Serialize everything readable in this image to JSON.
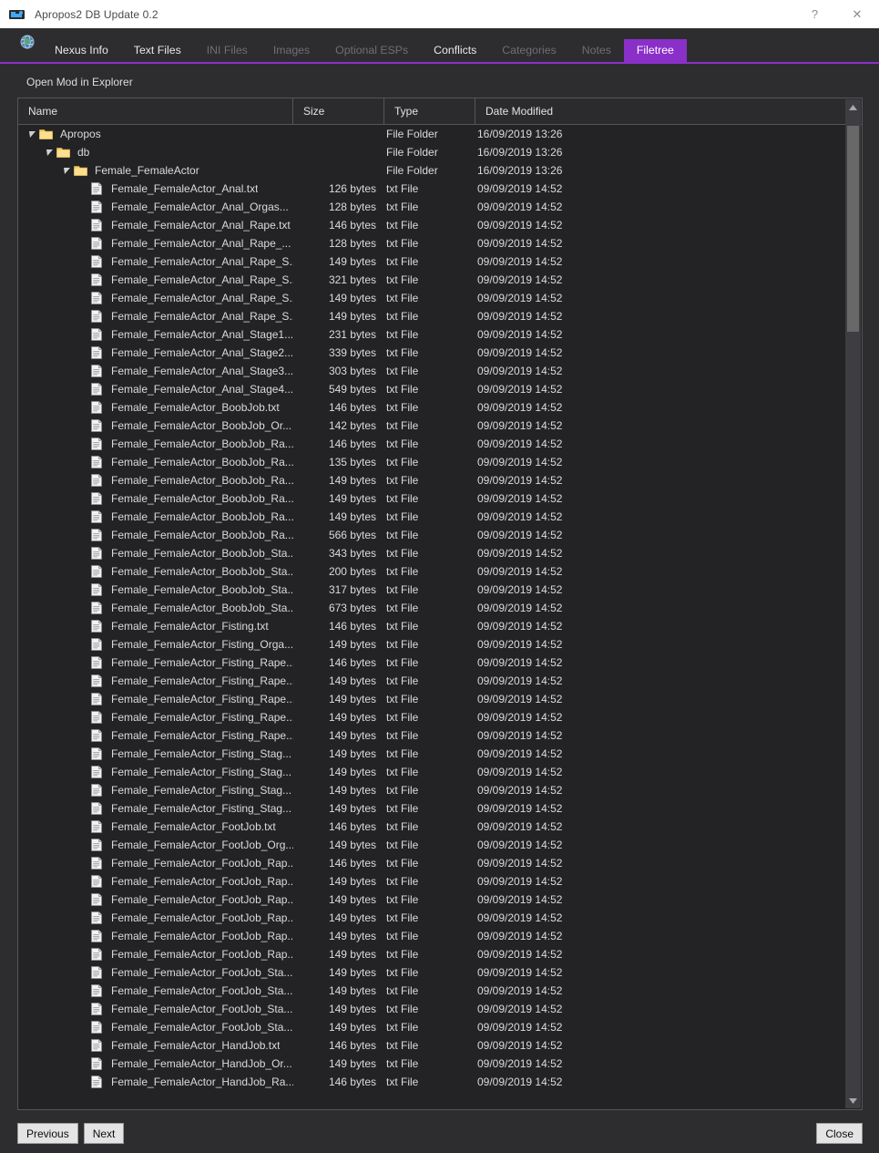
{
  "window": {
    "title": "Apropos2 DB Update 0.2",
    "icon": "window-icon",
    "help_label": "?",
    "close_label": "✕"
  },
  "tabs": [
    {
      "label": "Nexus Info",
      "state": "normal",
      "icon": "globe-icon"
    },
    {
      "label": "Text Files",
      "state": "normal"
    },
    {
      "label": "INI Files",
      "state": "disabled"
    },
    {
      "label": "Images",
      "state": "disabled"
    },
    {
      "label": "Optional ESPs",
      "state": "disabled"
    },
    {
      "label": "Conflicts",
      "state": "normal"
    },
    {
      "label": "Categories",
      "state": "disabled"
    },
    {
      "label": "Notes",
      "state": "disabled"
    },
    {
      "label": "Filetree",
      "state": "active"
    }
  ],
  "accent_color": "#8b2fc9",
  "toolbar": {
    "open_mod_label": "Open Mod in Explorer"
  },
  "tree": {
    "columns": [
      "Name",
      "Size",
      "Type",
      "Date Modified"
    ],
    "rows": [
      {
        "depth": 0,
        "kind": "folder",
        "expanded": true,
        "name": "Apropos",
        "size": "",
        "type": "File Folder",
        "date": "16/09/2019 13:26"
      },
      {
        "depth": 1,
        "kind": "folder",
        "expanded": true,
        "name": "db",
        "size": "",
        "type": "File Folder",
        "date": "16/09/2019 13:26"
      },
      {
        "depth": 2,
        "kind": "folder",
        "expanded": true,
        "name": "Female_FemaleActor",
        "size": "",
        "type": "File Folder",
        "date": "16/09/2019 13:26"
      },
      {
        "depth": 3,
        "kind": "file",
        "name": "Female_FemaleActor_Anal.txt",
        "size": "126 bytes",
        "type": "txt File",
        "date": "09/09/2019 14:52"
      },
      {
        "depth": 3,
        "kind": "file",
        "name": "Female_FemaleActor_Anal_Orgas...",
        "size": "128 bytes",
        "type": "txt File",
        "date": "09/09/2019 14:52"
      },
      {
        "depth": 3,
        "kind": "file",
        "name": "Female_FemaleActor_Anal_Rape.txt",
        "size": "146 bytes",
        "type": "txt File",
        "date": "09/09/2019 14:52"
      },
      {
        "depth": 3,
        "kind": "file",
        "name": "Female_FemaleActor_Anal_Rape_...",
        "size": "128 bytes",
        "type": "txt File",
        "date": "09/09/2019 14:52"
      },
      {
        "depth": 3,
        "kind": "file",
        "name": "Female_FemaleActor_Anal_Rape_S...",
        "size": "149 bytes",
        "type": "txt File",
        "date": "09/09/2019 14:52"
      },
      {
        "depth": 3,
        "kind": "file",
        "name": "Female_FemaleActor_Anal_Rape_S...",
        "size": "321 bytes",
        "type": "txt File",
        "date": "09/09/2019 14:52"
      },
      {
        "depth": 3,
        "kind": "file",
        "name": "Female_FemaleActor_Anal_Rape_S...",
        "size": "149 bytes",
        "type": "txt File",
        "date": "09/09/2019 14:52"
      },
      {
        "depth": 3,
        "kind": "file",
        "name": "Female_FemaleActor_Anal_Rape_S...",
        "size": "149 bytes",
        "type": "txt File",
        "date": "09/09/2019 14:52"
      },
      {
        "depth": 3,
        "kind": "file",
        "name": "Female_FemaleActor_Anal_Stage1....",
        "size": "231 bytes",
        "type": "txt File",
        "date": "09/09/2019 14:52"
      },
      {
        "depth": 3,
        "kind": "file",
        "name": "Female_FemaleActor_Anal_Stage2....",
        "size": "339 bytes",
        "type": "txt File",
        "date": "09/09/2019 14:52"
      },
      {
        "depth": 3,
        "kind": "file",
        "name": "Female_FemaleActor_Anal_Stage3....",
        "size": "303 bytes",
        "type": "txt File",
        "date": "09/09/2019 14:52"
      },
      {
        "depth": 3,
        "kind": "file",
        "name": "Female_FemaleActor_Anal_Stage4....",
        "size": "549 bytes",
        "type": "txt File",
        "date": "09/09/2019 14:52"
      },
      {
        "depth": 3,
        "kind": "file",
        "name": "Female_FemaleActor_BoobJob.txt",
        "size": "146 bytes",
        "type": "txt File",
        "date": "09/09/2019 14:52"
      },
      {
        "depth": 3,
        "kind": "file",
        "name": "Female_FemaleActor_BoobJob_Or...",
        "size": "142 bytes",
        "type": "txt File",
        "date": "09/09/2019 14:52"
      },
      {
        "depth": 3,
        "kind": "file",
        "name": "Female_FemaleActor_BoobJob_Ra...",
        "size": "146 bytes",
        "type": "txt File",
        "date": "09/09/2019 14:52"
      },
      {
        "depth": 3,
        "kind": "file",
        "name": "Female_FemaleActor_BoobJob_Ra...",
        "size": "135 bytes",
        "type": "txt File",
        "date": "09/09/2019 14:52"
      },
      {
        "depth": 3,
        "kind": "file",
        "name": "Female_FemaleActor_BoobJob_Ra...",
        "size": "149 bytes",
        "type": "txt File",
        "date": "09/09/2019 14:52"
      },
      {
        "depth": 3,
        "kind": "file",
        "name": "Female_FemaleActor_BoobJob_Ra...",
        "size": "149 bytes",
        "type": "txt File",
        "date": "09/09/2019 14:52"
      },
      {
        "depth": 3,
        "kind": "file",
        "name": "Female_FemaleActor_BoobJob_Ra...",
        "size": "149 bytes",
        "type": "txt File",
        "date": "09/09/2019 14:52"
      },
      {
        "depth": 3,
        "kind": "file",
        "name": "Female_FemaleActor_BoobJob_Ra...",
        "size": "566 bytes",
        "type": "txt File",
        "date": "09/09/2019 14:52"
      },
      {
        "depth": 3,
        "kind": "file",
        "name": "Female_FemaleActor_BoobJob_Sta...",
        "size": "343 bytes",
        "type": "txt File",
        "date": "09/09/2019 14:52"
      },
      {
        "depth": 3,
        "kind": "file",
        "name": "Female_FemaleActor_BoobJob_Sta...",
        "size": "200 bytes",
        "type": "txt File",
        "date": "09/09/2019 14:52"
      },
      {
        "depth": 3,
        "kind": "file",
        "name": "Female_FemaleActor_BoobJob_Sta...",
        "size": "317 bytes",
        "type": "txt File",
        "date": "09/09/2019 14:52"
      },
      {
        "depth": 3,
        "kind": "file",
        "name": "Female_FemaleActor_BoobJob_Sta...",
        "size": "673 bytes",
        "type": "txt File",
        "date": "09/09/2019 14:52"
      },
      {
        "depth": 3,
        "kind": "file",
        "name": "Female_FemaleActor_Fisting.txt",
        "size": "146 bytes",
        "type": "txt File",
        "date": "09/09/2019 14:52"
      },
      {
        "depth": 3,
        "kind": "file",
        "name": "Female_FemaleActor_Fisting_Orga...",
        "size": "149 bytes",
        "type": "txt File",
        "date": "09/09/2019 14:52"
      },
      {
        "depth": 3,
        "kind": "file",
        "name": "Female_FemaleActor_Fisting_Rape...",
        "size": "146 bytes",
        "type": "txt File",
        "date": "09/09/2019 14:52"
      },
      {
        "depth": 3,
        "kind": "file",
        "name": "Female_FemaleActor_Fisting_Rape...",
        "size": "149 bytes",
        "type": "txt File",
        "date": "09/09/2019 14:52"
      },
      {
        "depth": 3,
        "kind": "file",
        "name": "Female_FemaleActor_Fisting_Rape...",
        "size": "149 bytes",
        "type": "txt File",
        "date": "09/09/2019 14:52"
      },
      {
        "depth": 3,
        "kind": "file",
        "name": "Female_FemaleActor_Fisting_Rape...",
        "size": "149 bytes",
        "type": "txt File",
        "date": "09/09/2019 14:52"
      },
      {
        "depth": 3,
        "kind": "file",
        "name": "Female_FemaleActor_Fisting_Rape...",
        "size": "149 bytes",
        "type": "txt File",
        "date": "09/09/2019 14:52"
      },
      {
        "depth": 3,
        "kind": "file",
        "name": "Female_FemaleActor_Fisting_Stag...",
        "size": "149 bytes",
        "type": "txt File",
        "date": "09/09/2019 14:52"
      },
      {
        "depth": 3,
        "kind": "file",
        "name": "Female_FemaleActor_Fisting_Stag...",
        "size": "149 bytes",
        "type": "txt File",
        "date": "09/09/2019 14:52"
      },
      {
        "depth": 3,
        "kind": "file",
        "name": "Female_FemaleActor_Fisting_Stag...",
        "size": "149 bytes",
        "type": "txt File",
        "date": "09/09/2019 14:52"
      },
      {
        "depth": 3,
        "kind": "file",
        "name": "Female_FemaleActor_Fisting_Stag...",
        "size": "149 bytes",
        "type": "txt File",
        "date": "09/09/2019 14:52"
      },
      {
        "depth": 3,
        "kind": "file",
        "name": "Female_FemaleActor_FootJob.txt",
        "size": "146 bytes",
        "type": "txt File",
        "date": "09/09/2019 14:52"
      },
      {
        "depth": 3,
        "kind": "file",
        "name": "Female_FemaleActor_FootJob_Org...",
        "size": "149 bytes",
        "type": "txt File",
        "date": "09/09/2019 14:52"
      },
      {
        "depth": 3,
        "kind": "file",
        "name": "Female_FemaleActor_FootJob_Rap...",
        "size": "146 bytes",
        "type": "txt File",
        "date": "09/09/2019 14:52"
      },
      {
        "depth": 3,
        "kind": "file",
        "name": "Female_FemaleActor_FootJob_Rap...",
        "size": "149 bytes",
        "type": "txt File",
        "date": "09/09/2019 14:52"
      },
      {
        "depth": 3,
        "kind": "file",
        "name": "Female_FemaleActor_FootJob_Rap...",
        "size": "149 bytes",
        "type": "txt File",
        "date": "09/09/2019 14:52"
      },
      {
        "depth": 3,
        "kind": "file",
        "name": "Female_FemaleActor_FootJob_Rap...",
        "size": "149 bytes",
        "type": "txt File",
        "date": "09/09/2019 14:52"
      },
      {
        "depth": 3,
        "kind": "file",
        "name": "Female_FemaleActor_FootJob_Rap...",
        "size": "149 bytes",
        "type": "txt File",
        "date": "09/09/2019 14:52"
      },
      {
        "depth": 3,
        "kind": "file",
        "name": "Female_FemaleActor_FootJob_Rap...",
        "size": "149 bytes",
        "type": "txt File",
        "date": "09/09/2019 14:52"
      },
      {
        "depth": 3,
        "kind": "file",
        "name": "Female_FemaleActor_FootJob_Sta...",
        "size": "149 bytes",
        "type": "txt File",
        "date": "09/09/2019 14:52"
      },
      {
        "depth": 3,
        "kind": "file",
        "name": "Female_FemaleActor_FootJob_Sta...",
        "size": "149 bytes",
        "type": "txt File",
        "date": "09/09/2019 14:52"
      },
      {
        "depth": 3,
        "kind": "file",
        "name": "Female_FemaleActor_FootJob_Sta...",
        "size": "149 bytes",
        "type": "txt File",
        "date": "09/09/2019 14:52"
      },
      {
        "depth": 3,
        "kind": "file",
        "name": "Female_FemaleActor_FootJob_Sta...",
        "size": "149 bytes",
        "type": "txt File",
        "date": "09/09/2019 14:52"
      },
      {
        "depth": 3,
        "kind": "file",
        "name": "Female_FemaleActor_HandJob.txt",
        "size": "146 bytes",
        "type": "txt File",
        "date": "09/09/2019 14:52"
      },
      {
        "depth": 3,
        "kind": "file",
        "name": "Female_FemaleActor_HandJob_Or...",
        "size": "149 bytes",
        "type": "txt File",
        "date": "09/09/2019 14:52"
      },
      {
        "depth": 3,
        "kind": "file",
        "name": "Female_FemaleActor_HandJob_Ra...",
        "size": "146 bytes",
        "type": "txt File",
        "date": "09/09/2019 14:52"
      }
    ]
  },
  "footer": {
    "previous_label": "Previous",
    "next_label": "Next",
    "close_label": "Close"
  }
}
